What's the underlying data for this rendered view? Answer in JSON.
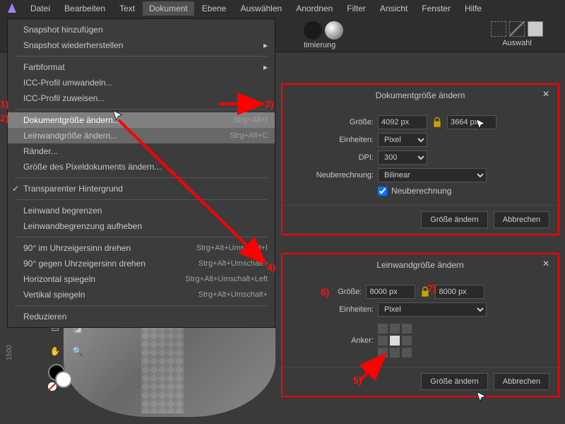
{
  "menubar": [
    "Datei",
    "Bearbeiten",
    "Text",
    "Dokument",
    "Ebene",
    "Auswählen",
    "Anordnen",
    "Filter",
    "Ansicht",
    "Fenster",
    "Hilfe"
  ],
  "toolbar": {
    "opt_label": "timierung",
    "sel_label": "Auswahl"
  },
  "dropdown": {
    "snapshot_add": "Snapshot hinzufügen",
    "snapshot_restore": "Snapshot wiederherstellen",
    "colorformat": "Farbformat",
    "icc_convert": "ICC-Profil umwandeln...",
    "icc_assign": "ICC-Profil zuweisen...",
    "doc_resize": "Dokumentgröße ändern...",
    "doc_resize_sc": "Strg+Alt+I",
    "canvas_resize": "Leinwandgröße ändern...",
    "canvas_resize_sc": "Strg+Alt+C",
    "margins": "Ränder...",
    "pixeldoc": "Größe des Pixeldokuments ändern...",
    "transparent": "Transparenter Hintergrund",
    "canvas_clip": "Leinwand begrenzen",
    "canvas_unclip": "Leinwandbegrenzung aufheben",
    "rot_cw": "90° im Uhrzeigersinn drehen",
    "rot_cw_sc": "Strg+Alt+Umschalt+I",
    "rot_ccw": "90° gegen Uhrzeigersinn drehen",
    "rot_ccw_sc": "Strg+Alt+Umschalt+",
    "flip_h": "Horizontal spiegeln",
    "flip_h_sc": "Strg+Alt+Umschalt+Left",
    "flip_v": "Vertikal spiegeln",
    "flip_v_sc": "Strg+Alt+Umschalt+",
    "flatten": "Reduzieren"
  },
  "dlg1": {
    "title": "Dokumentgröße ändern",
    "size_lbl": "Größe:",
    "units_lbl": "Einheiten:",
    "dpi_lbl": "DPI:",
    "resample_lbl": "Neuberechnung:",
    "w": "4092 px",
    "h": "3664 px",
    "units": "Pixel",
    "dpi": "300",
    "resample_mode": "Bilinear",
    "resample_cb": "Neuberechnung",
    "ok": "Größe ändern",
    "cancel": "Abbrechen"
  },
  "dlg2": {
    "title": "Leinwandgröße ändern",
    "size_lbl": "Größe:",
    "units_lbl": "Einheiten:",
    "anchor_lbl": "Anker:",
    "w": "8000 px",
    "h": "8000 px",
    "units": "Pixel",
    "ok": "Größe ändern",
    "cancel": "Abbrechen"
  },
  "annotations": {
    "n1": "1)",
    "n2": "2)",
    "n3": "3)",
    "n4": "4)",
    "n5": "5)",
    "n6": "6)",
    "n7": "7)"
  },
  "ruler": "1500"
}
